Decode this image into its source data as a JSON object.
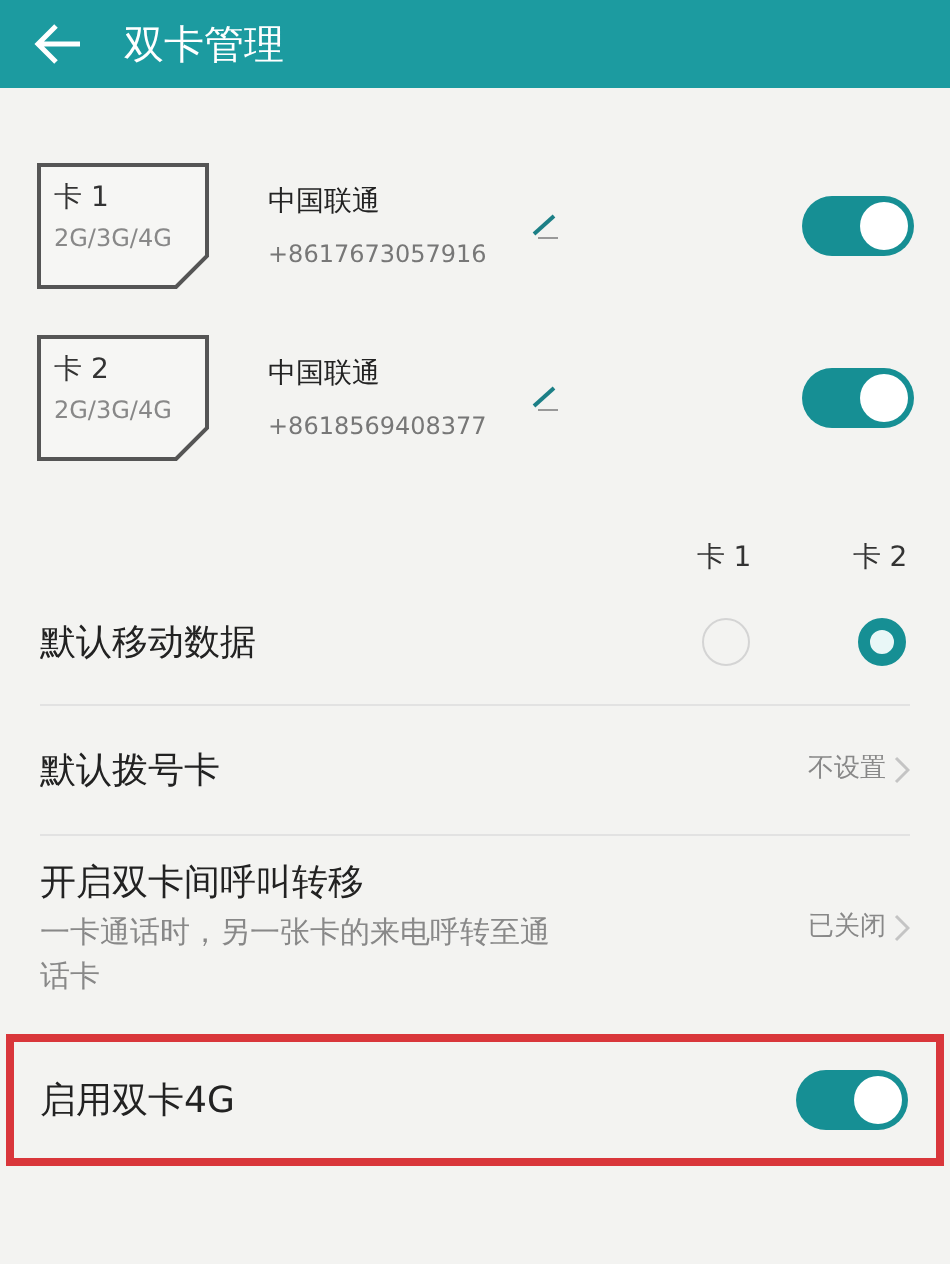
{
  "header": {
    "title": "双卡管理"
  },
  "sims": [
    {
      "label": "卡 1",
      "bands": "2G/3G/4G",
      "carrier": "中国联通",
      "number": "+8617673057916",
      "on": true
    },
    {
      "label": "卡 2",
      "bands": "2G/3G/4G",
      "carrier": "中国联通",
      "number": "+8618569408377",
      "on": true
    }
  ],
  "data_columns": [
    "卡 1",
    "卡 2"
  ],
  "default_data": {
    "label": "默认移动数据",
    "options": [
      {
        "selected": false
      },
      {
        "selected": true
      }
    ]
  },
  "settings": [
    {
      "kind": "link",
      "title": "默认拨号卡",
      "value": "不设置"
    },
    {
      "kind": "link",
      "title": "开启双卡间呼叫转移",
      "subtitle": "一卡通话时，另一张卡的来电呼转至通话卡",
      "value": "已关闭"
    },
    {
      "kind": "toggle",
      "title": "启用双卡4G",
      "on": true,
      "highlighted": true
    }
  ]
}
